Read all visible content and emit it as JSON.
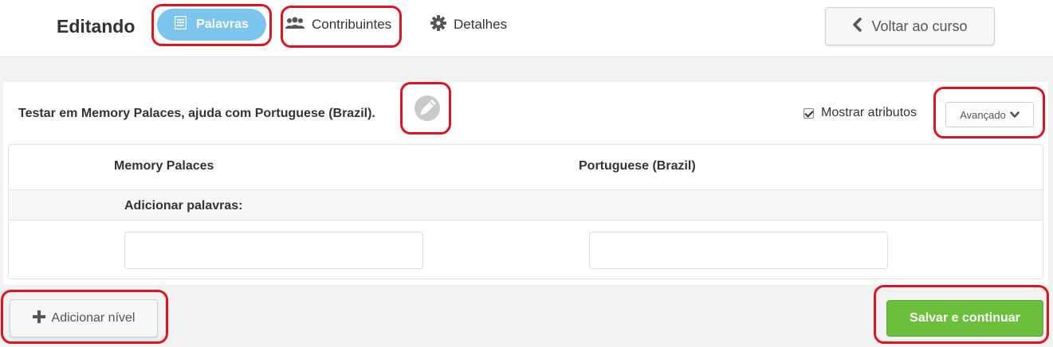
{
  "header": {
    "editing_label": "Editando",
    "tabs": [
      {
        "label": "Palavras",
        "icon": "list-icon",
        "active": true
      },
      {
        "label": "Contribuintes",
        "icon": "people-icon",
        "active": false
      },
      {
        "label": "Detalhes",
        "icon": "gear-icon",
        "active": false
      }
    ],
    "back_button": {
      "label": "Voltar ao curso",
      "icon": "chevron-left-icon"
    }
  },
  "level": {
    "title": "Testar em Memory Palaces, ajuda com Portuguese (Brazil).",
    "edit_icon": "pencil-icon",
    "show_attributes": {
      "label": "Mostrar atributos",
      "checked": true
    },
    "advanced_button": {
      "label": "Avançado",
      "icon": "chevron-down-icon"
    }
  },
  "table": {
    "columns": [
      "Memory Palaces",
      "Portuguese (Brazil)"
    ],
    "add_words_label": "Adicionar palavras:",
    "inputs": [
      {
        "value": "",
        "placeholder": ""
      },
      {
        "value": "",
        "placeholder": ""
      }
    ]
  },
  "footer": {
    "add_level_button": {
      "label": "Adicionar nível",
      "icon": "plus-icon"
    },
    "save_button": {
      "label": "Salvar e continuar"
    }
  },
  "colors": {
    "active_tab": "#7bc5ef",
    "save_button": "#6cbf3c",
    "highlight": "#e0141e"
  }
}
